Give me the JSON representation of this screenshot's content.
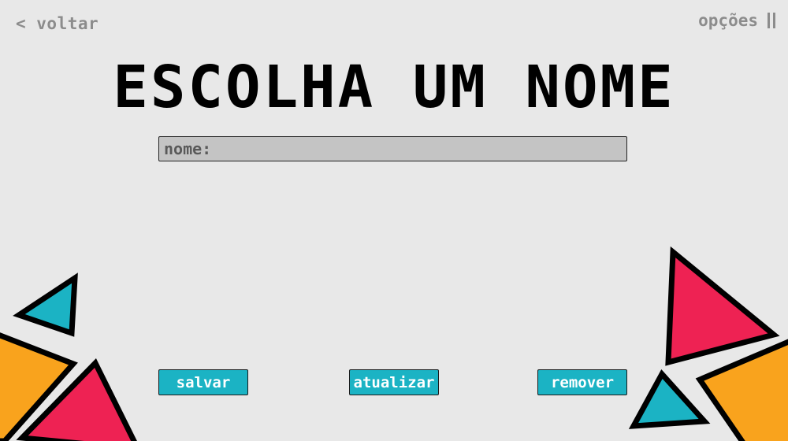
{
  "nav": {
    "back_label": "< voltar",
    "options_label": "opções"
  },
  "screen": {
    "title": "ESCOLHA UM NOME"
  },
  "name_input": {
    "placeholder": "nome:",
    "value": ""
  },
  "actions": {
    "save_label": "salvar",
    "update_label": "atualizar",
    "remove_label": "remover"
  },
  "colors": {
    "background": "#e8e8e8",
    "accent": "#1bb3c4",
    "triangle_pink": "#ee2253",
    "triangle_orange": "#f9a31d",
    "triangle_cyan": "#1bb3c4"
  }
}
